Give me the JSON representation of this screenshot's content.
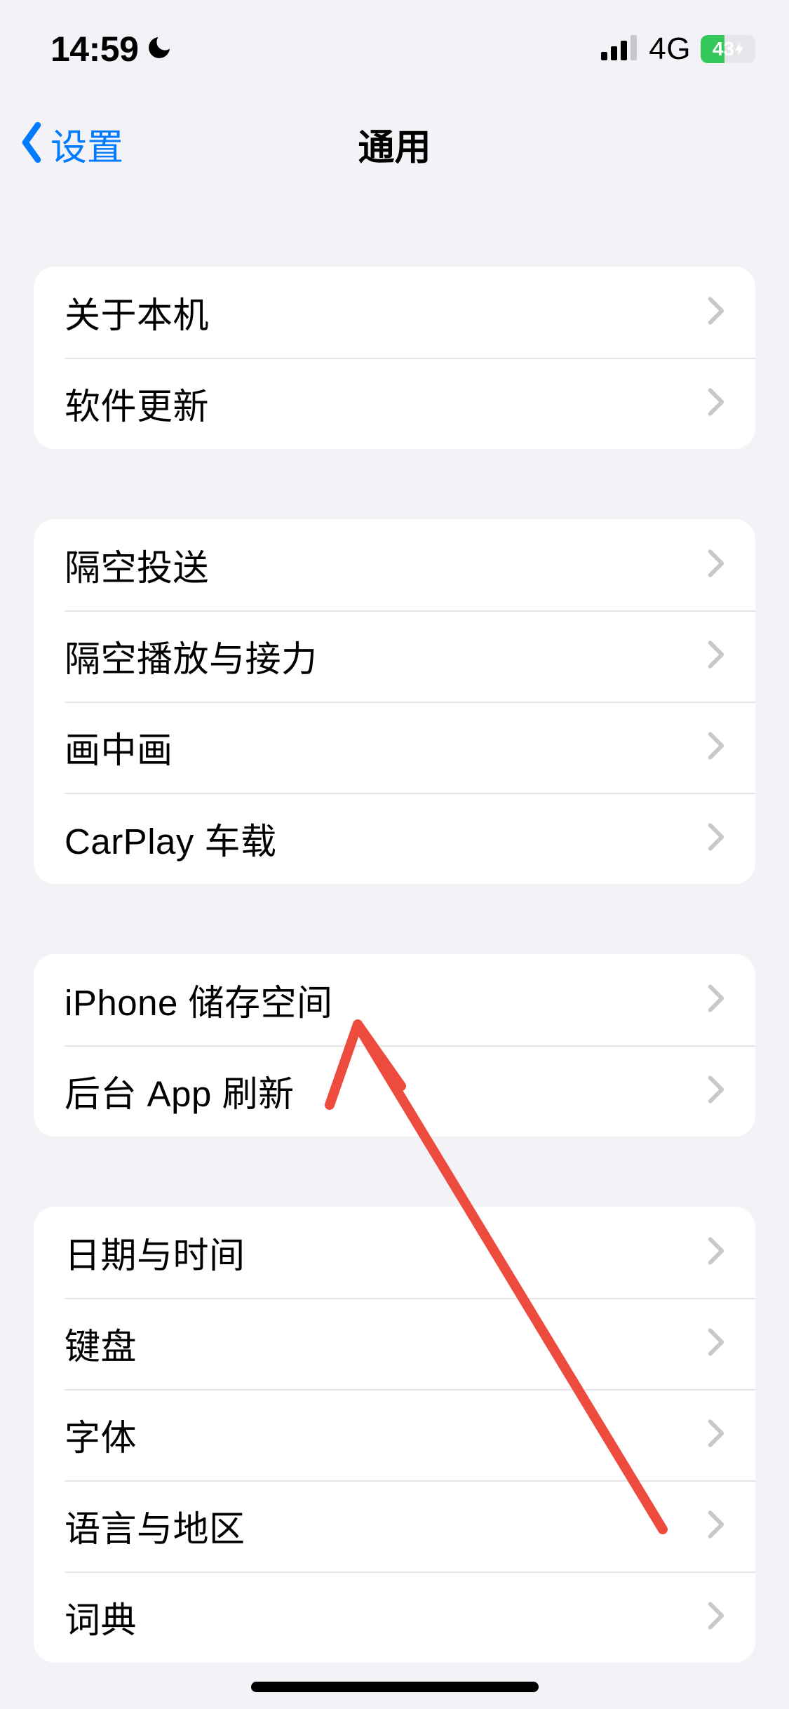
{
  "status": {
    "time": "14:59",
    "network": "4G",
    "battery_pct": "43"
  },
  "nav": {
    "back_label": "设置",
    "title": "通用"
  },
  "groups": {
    "g1": {
      "about": "关于本机",
      "software_update": "软件更新"
    },
    "g2": {
      "airdrop": "隔空投送",
      "airplay_handoff": "隔空播放与接力",
      "pip": "画中画",
      "carplay": "CarPlay 车载"
    },
    "g3": {
      "storage": "iPhone 储存空间",
      "background_refresh": "后台 App 刷新"
    },
    "g4": {
      "date_time": "日期与时间",
      "keyboard": "键盘",
      "fonts": "字体",
      "language_region": "语言与地区",
      "dictionary": "词典"
    }
  }
}
